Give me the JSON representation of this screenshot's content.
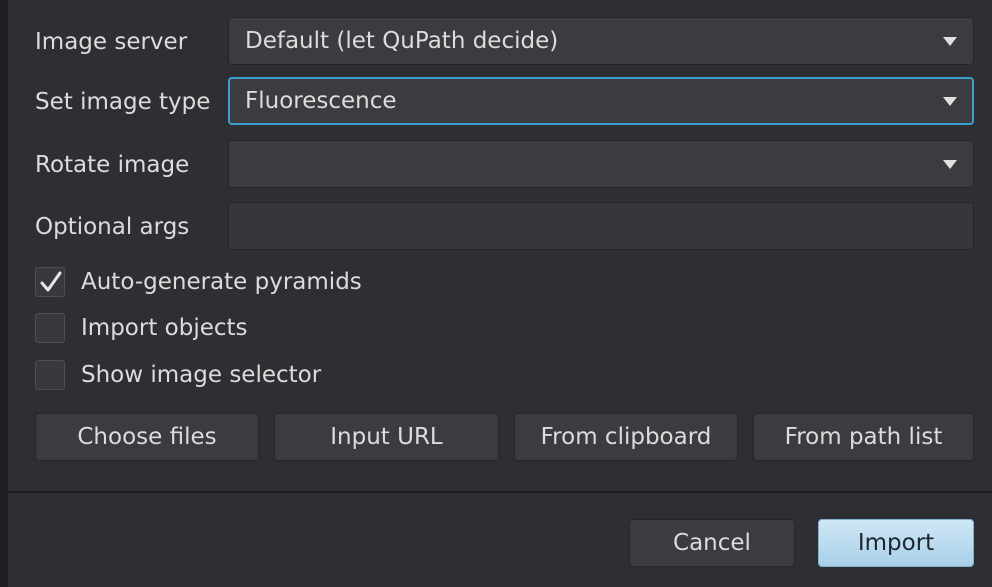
{
  "form": {
    "image_server": {
      "label": "Image server",
      "value": "Default (let QuPath decide)"
    },
    "image_type": {
      "label": "Set image type",
      "value": "Fluorescence"
    },
    "rotate": {
      "label": "Rotate image",
      "value": ""
    },
    "optional_args": {
      "label": "Optional args",
      "value": ""
    }
  },
  "checkboxes": [
    {
      "label": "Auto-generate pyramids",
      "checked": true
    },
    {
      "label": "Import objects",
      "checked": false
    },
    {
      "label": "Show image selector",
      "checked": false
    }
  ],
  "source_buttons": {
    "choose_files": "Choose files",
    "input_url": "Input URL",
    "from_clipboard": "From clipboard",
    "from_path_list": "From path list"
  },
  "footer": {
    "cancel": "Cancel",
    "import": "Import"
  },
  "colors": {
    "background": "#2e2f33",
    "focus_border": "#3d9fd0",
    "primary_button": "#bfe0f2"
  },
  "icons": {
    "dropdown": "triangle-down",
    "check": "checkmark"
  }
}
